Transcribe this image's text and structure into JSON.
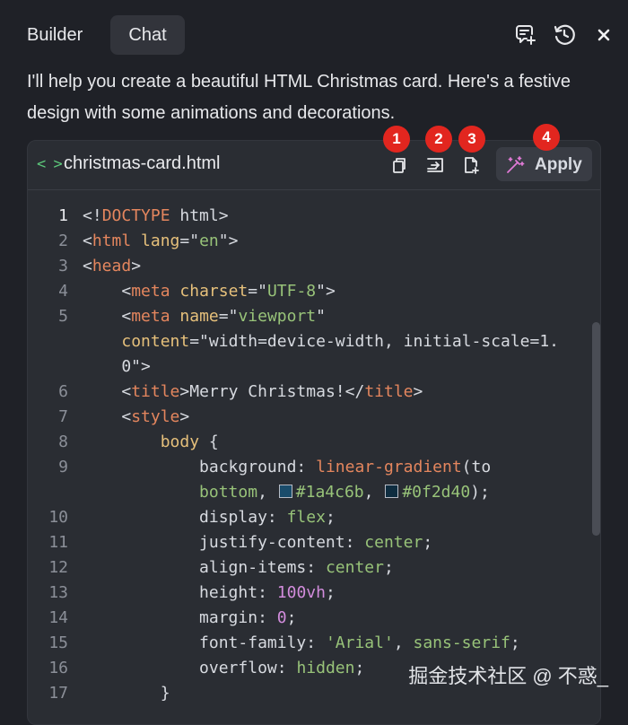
{
  "tabs": [
    {
      "label": "Builder",
      "active": false
    },
    {
      "label": "Chat",
      "active": true
    }
  ],
  "header_icons": [
    "new-chat-icon",
    "history-icon",
    "close-icon"
  ],
  "message": "I'll help you create a beautiful HTML Christmas card. Here's a festive design with some animations and decorations.",
  "code_block": {
    "icon": "code-icon",
    "filename": "christmas-card.html",
    "actions": [
      {
        "icon": "copy-icon",
        "badge": "1"
      },
      {
        "icon": "insert-icon",
        "badge": "2"
      },
      {
        "icon": "new-file-icon",
        "badge": "3"
      }
    ],
    "apply": {
      "icon": "magic-wand-icon",
      "label": "Apply",
      "badge": "4"
    },
    "lines": [
      {
        "n": "1",
        "text": "<!DOCTYPE html>"
      },
      {
        "n": "2",
        "text": "<html lang=\"en\">"
      },
      {
        "n": "3",
        "text": "<head>"
      },
      {
        "n": "4",
        "text": "    <meta charset=\"UTF-8\">"
      },
      {
        "n": "5",
        "text": "    <meta name=\"viewport\""
      },
      {
        "n": "",
        "text": "    content=\"width=device-width, initial-scale=1."
      },
      {
        "n": "",
        "text": "    0\">"
      },
      {
        "n": "6",
        "text": "    <title>Merry Christmas!</title>"
      },
      {
        "n": "7",
        "text": "    <style>"
      },
      {
        "n": "8",
        "text": "        body {"
      },
      {
        "n": "9",
        "text": "            background: linear-gradient(to"
      },
      {
        "n": "",
        "text": "            bottom, #1a4c6b, #0f2d40);"
      },
      {
        "n": "10",
        "text": "            display: flex;"
      },
      {
        "n": "11",
        "text": "            justify-content: center;"
      },
      {
        "n": "12",
        "text": "            align-items: center;"
      },
      {
        "n": "13",
        "text": "            height: 100vh;"
      },
      {
        "n": "14",
        "text": "            margin: 0;"
      },
      {
        "n": "15",
        "text": "            font-family: 'Arial', sans-serif;"
      },
      {
        "n": "16",
        "text": "            overflow: hidden;"
      },
      {
        "n": "17",
        "text": "        }"
      }
    ]
  },
  "watermark": "掘金技术社区 @ 不惑_",
  "colors": {
    "badge": "#e2261f",
    "background": "#1f2127",
    "accent": "#5cc77a",
    "swatch1": "#1a4c6b",
    "swatch2": "#0f2d40"
  }
}
